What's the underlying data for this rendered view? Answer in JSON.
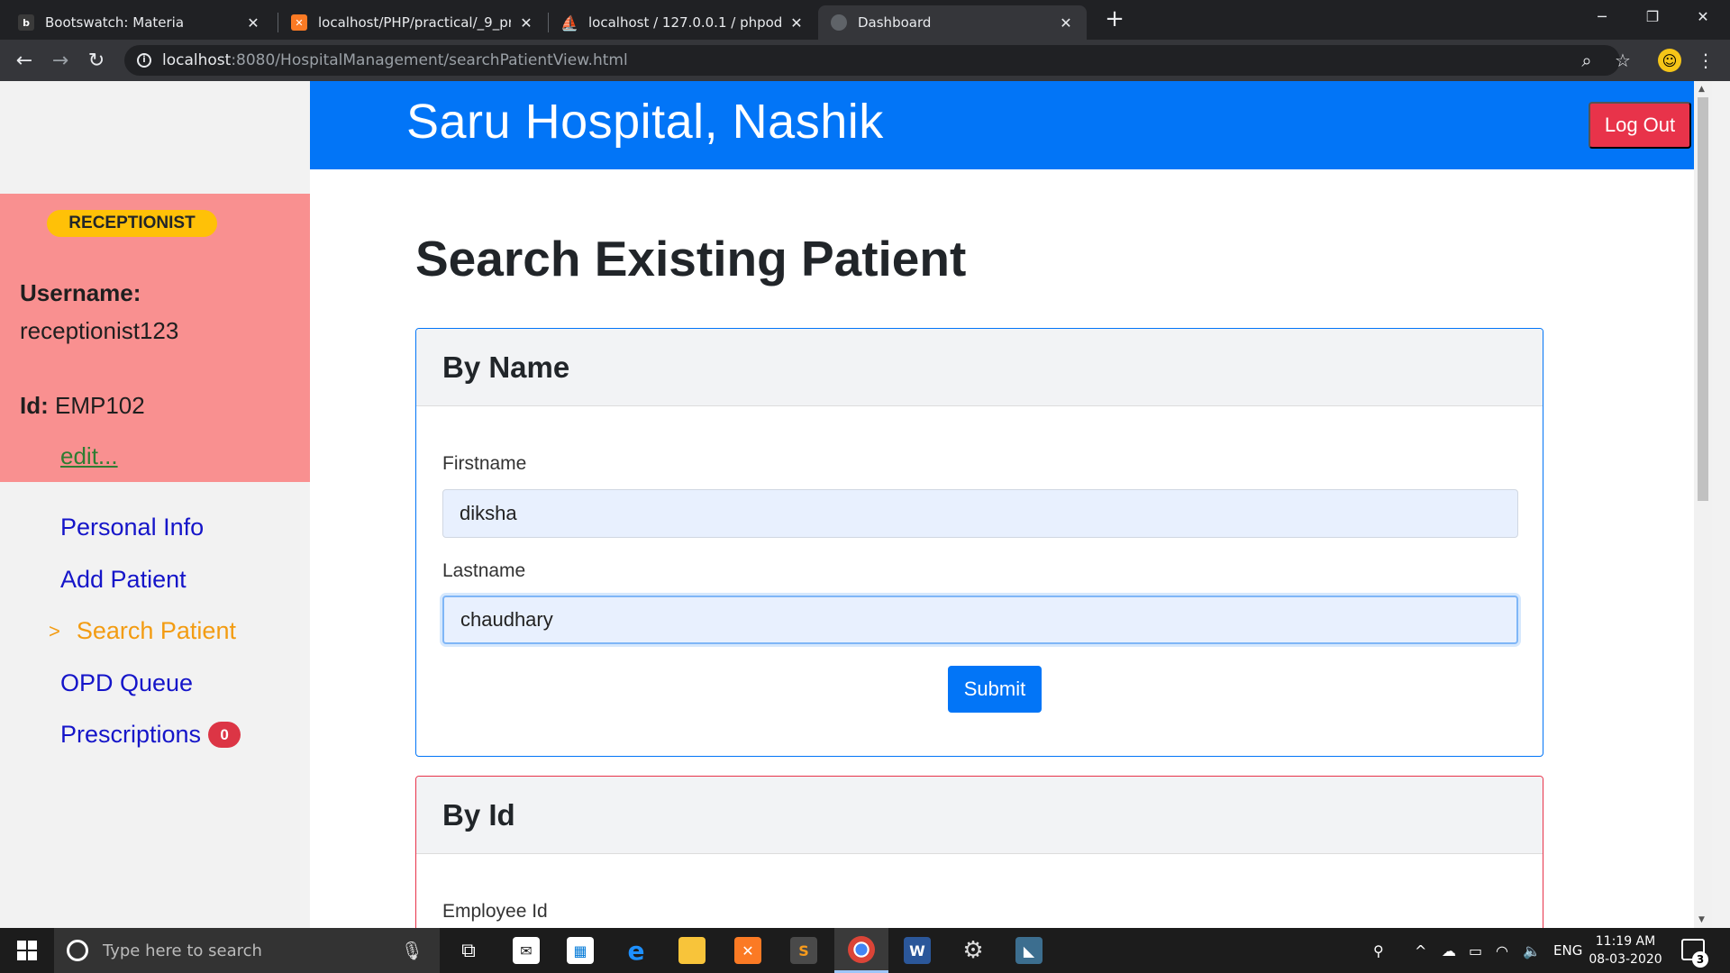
{
  "browser": {
    "tabs": [
      {
        "title": "Bootswatch: Materia",
        "favicon": "bootswatch-icon",
        "active": false
      },
      {
        "title": "localhost/PHP/practical/_9_practi",
        "favicon": "xampp-icon",
        "active": false
      },
      {
        "title": "localhost / 127.0.0.1 / phpodbcp",
        "favicon": "phpmyadmin-icon",
        "active": false
      },
      {
        "title": "Dashboard",
        "favicon": "globe-icon",
        "active": true
      }
    ],
    "url_host": "localhost",
    "url_rest": ":8080/HospitalManagement/searchPatientView.html"
  },
  "header": {
    "hospital_name": "Saru Hospital, Nashik",
    "logout_label": "Log Out"
  },
  "profile": {
    "role": "RECEPTIONIST",
    "username_label": "Username:",
    "username": "receptionist123",
    "id_label": "Id:",
    "id": "EMP102",
    "edit_label": "edit..."
  },
  "nav": {
    "items": [
      {
        "label": "Personal Info"
      },
      {
        "label": "Add Patient"
      },
      {
        "label": "Search Patient",
        "marker": ">"
      },
      {
        "label": "OPD Queue"
      },
      {
        "label": "Prescriptions",
        "badge": "0"
      }
    ]
  },
  "main": {
    "title": "Search Existing Patient",
    "by_name": {
      "header": "By Name",
      "firstname_label": "Firstname",
      "firstname_value": "diksha",
      "lastname_label": "Lastname",
      "lastname_value": "chaudhary",
      "submit_label": "Submit"
    },
    "by_id": {
      "header": "By Id",
      "employee_id_label": "Employee Id"
    }
  },
  "taskbar": {
    "search_placeholder": "Type here to search",
    "language": "ENG",
    "time": "11:19 AM",
    "date": "08-03-2020",
    "notification_count": "3"
  },
  "colors": {
    "header_blue": "#0275f7",
    "profile_bg": "#f99090",
    "role_badge": "#ffc107",
    "logout_red": "#e8334a",
    "nav_link": "#1515c9",
    "nav_active": "#f39c12"
  }
}
